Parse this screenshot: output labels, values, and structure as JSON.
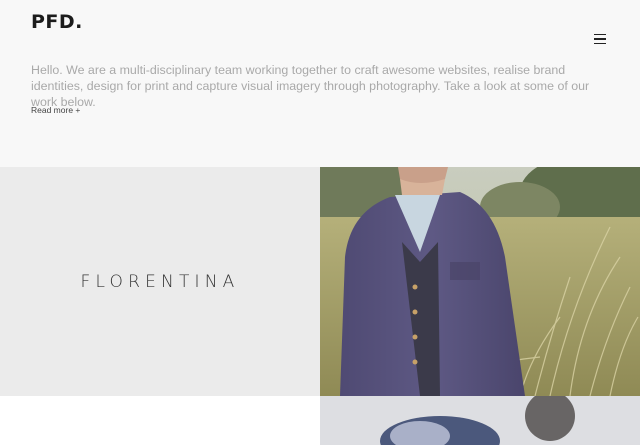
{
  "header": {
    "logo": "PFD.",
    "menu_icon": "hamburger-menu-icon",
    "intro_text": "Hello. We are a multi-disciplinary team working together to craft awesome websites, realise brand identities, design for print and capture visual imagery through photography. Take a look at some of our work below.",
    "read_more": "Read more +"
  },
  "portfolio": {
    "items": [
      {
        "label": "FLORENTINA"
      }
    ]
  },
  "colors": {
    "page_background": "#f8f8f8",
    "tile_background": "#ebebeb",
    "intro_text": "#a9a9a9",
    "logo": "#1c1c1c"
  }
}
